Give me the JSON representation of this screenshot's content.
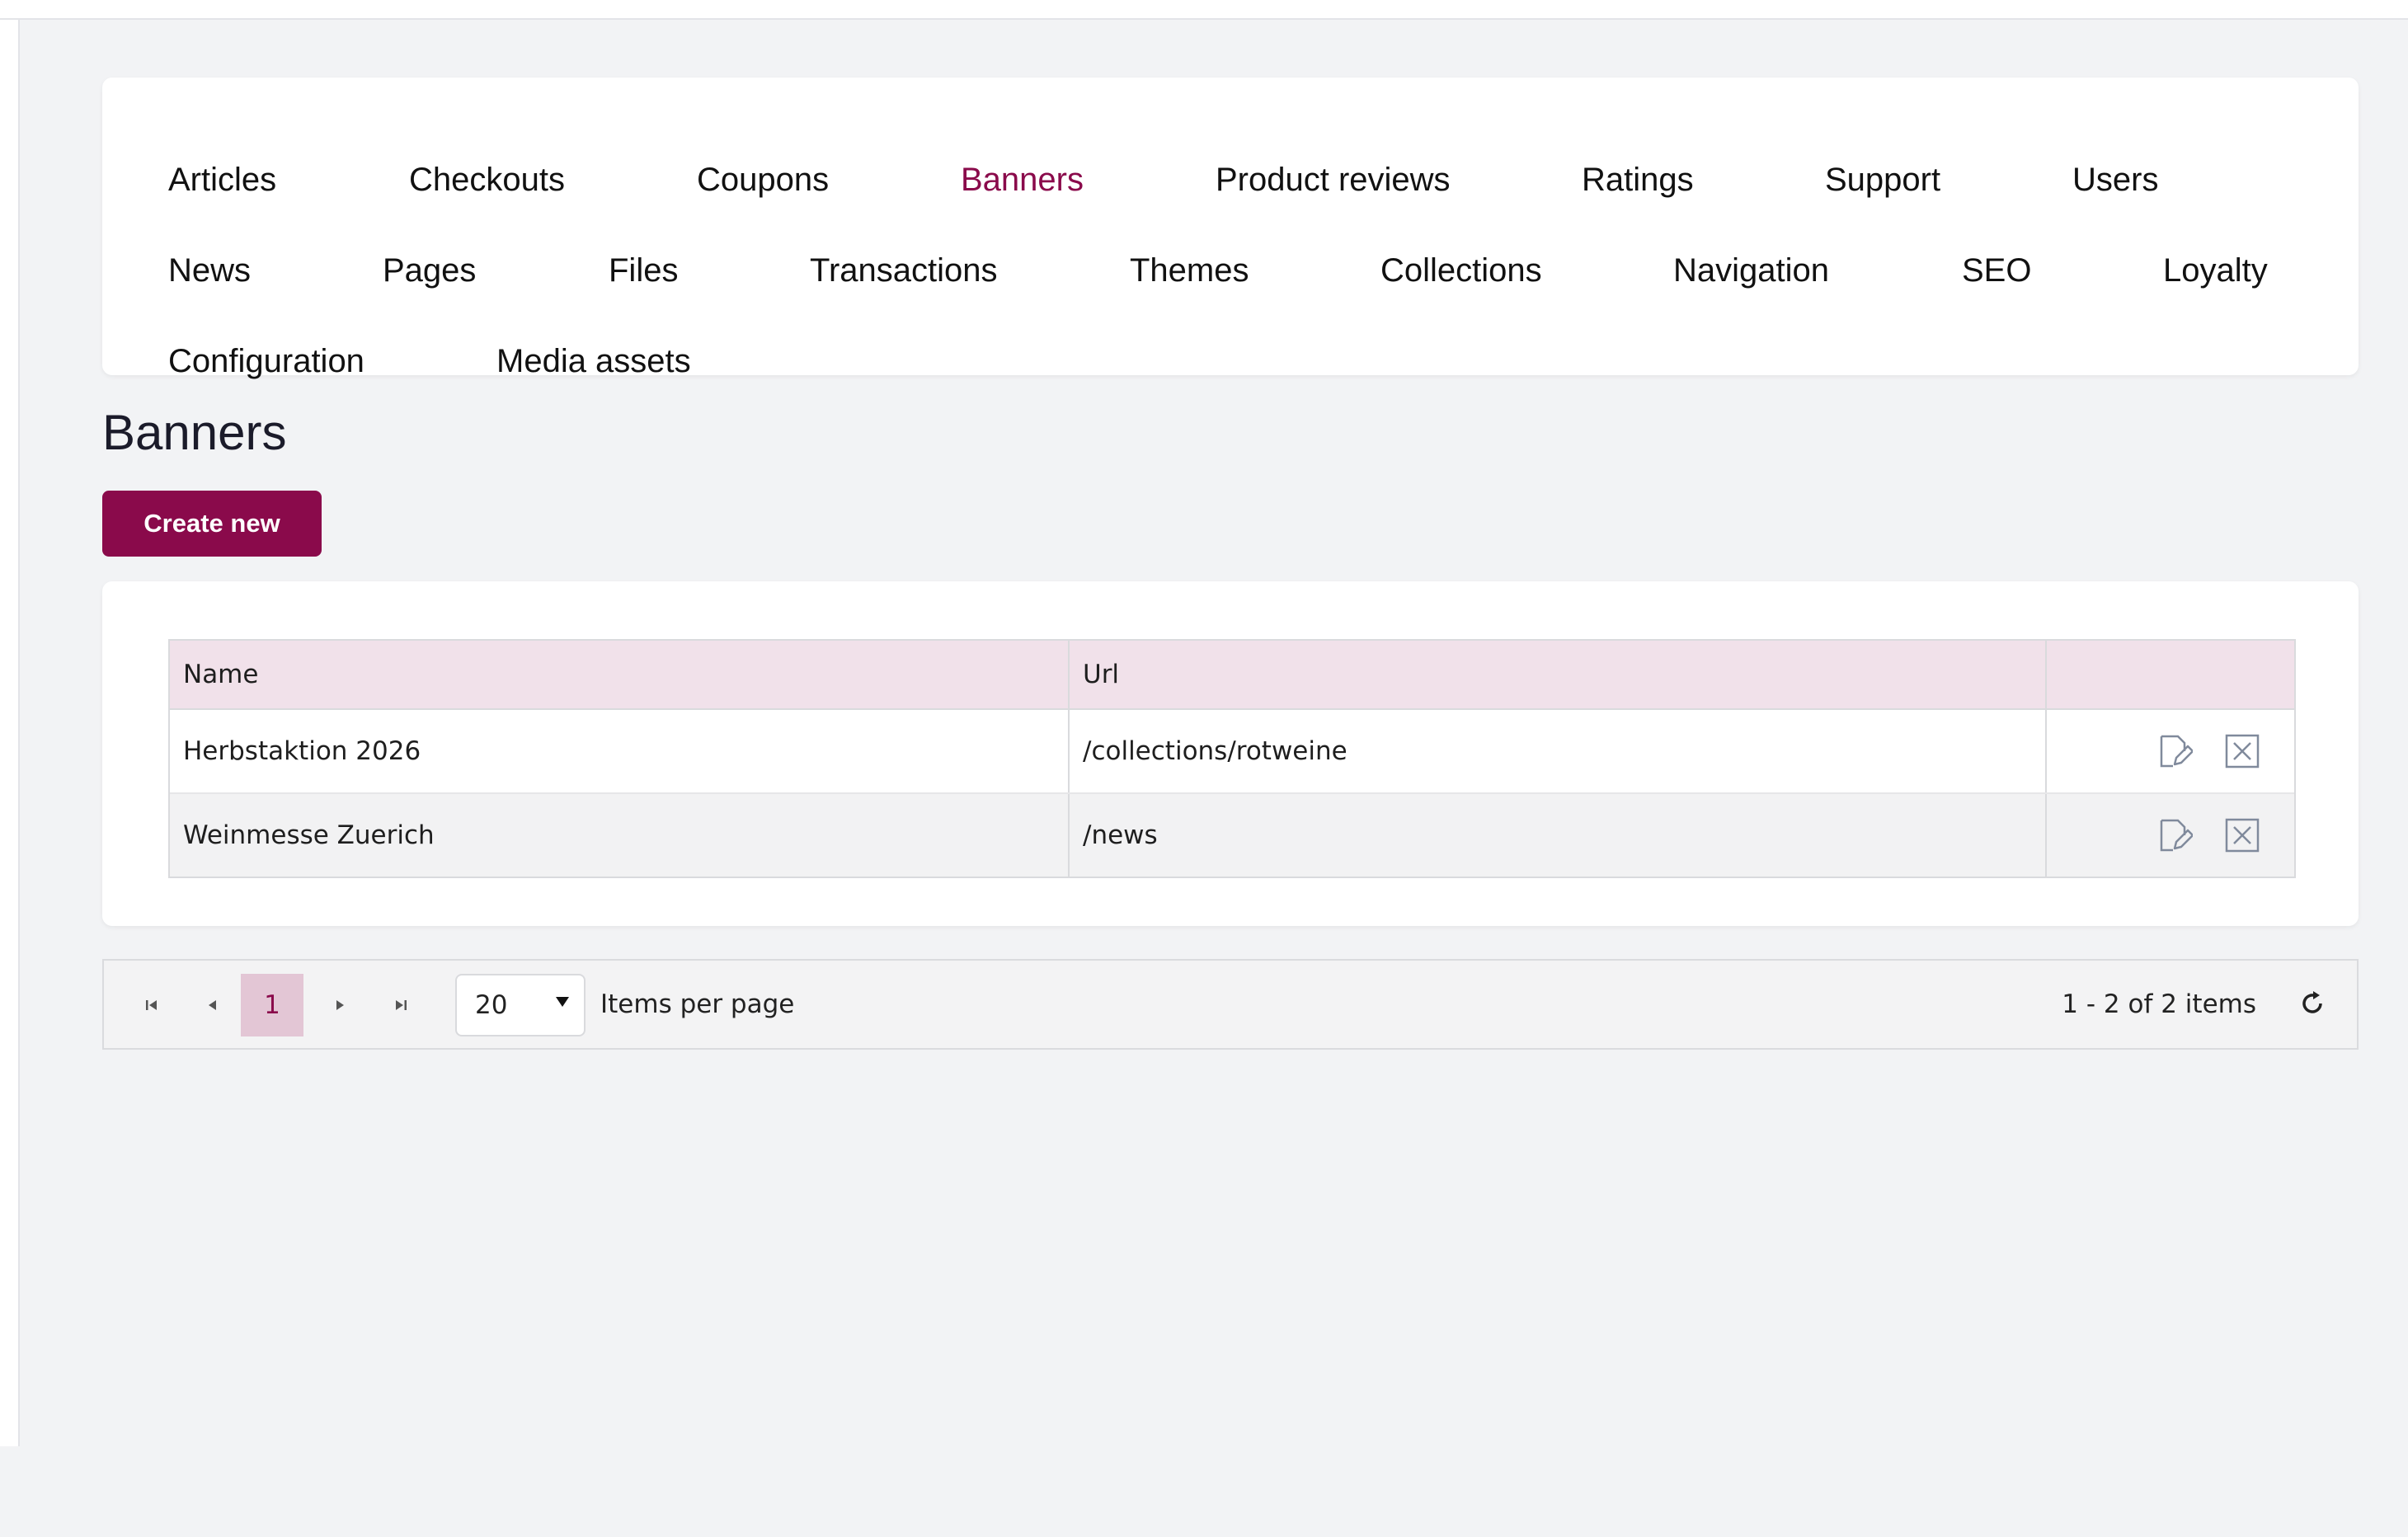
{
  "nav": {
    "items": [
      {
        "label": "Articles",
        "active": false
      },
      {
        "label": "Checkouts",
        "active": false
      },
      {
        "label": "Coupons",
        "active": false
      },
      {
        "label": "Banners",
        "active": true
      },
      {
        "label": "Product reviews",
        "active": false
      },
      {
        "label": "Ratings",
        "active": false
      },
      {
        "label": "Support",
        "active": false
      },
      {
        "label": "Users",
        "active": false
      },
      {
        "label": "News",
        "active": false
      },
      {
        "label": "Pages",
        "active": false
      },
      {
        "label": "Files",
        "active": false
      },
      {
        "label": "Transactions",
        "active": false
      },
      {
        "label": "Themes",
        "active": false
      },
      {
        "label": "Collections",
        "active": false
      },
      {
        "label": "Navigation",
        "active": false
      },
      {
        "label": "SEO",
        "active": false
      },
      {
        "label": "Loyalty",
        "active": false
      },
      {
        "label": "Configuration",
        "active": false
      },
      {
        "label": "Media assets",
        "active": false
      }
    ]
  },
  "page": {
    "title": "Banners",
    "create_label": "Create new"
  },
  "table": {
    "columns": [
      "Name",
      "Url",
      ""
    ],
    "rows": [
      {
        "name": "Herbstaktion 2026",
        "url": "/collections/rotweine"
      },
      {
        "name": "Weinmesse Zuerich",
        "url": "/news"
      }
    ],
    "row_actions": [
      "edit-icon",
      "delete-icon"
    ]
  },
  "pager": {
    "current_page": "1",
    "page_size": "20",
    "page_size_label": "Items per page",
    "info": "1 - 2 of 2 items",
    "icons": [
      "first-page-icon",
      "prev-page-icon",
      "next-page-icon",
      "last-page-icon",
      "refresh-icon"
    ]
  },
  "colors": {
    "accent": "#8a0a4b",
    "header_bg": "#f1e1ea",
    "background": "#f2f3f5"
  }
}
